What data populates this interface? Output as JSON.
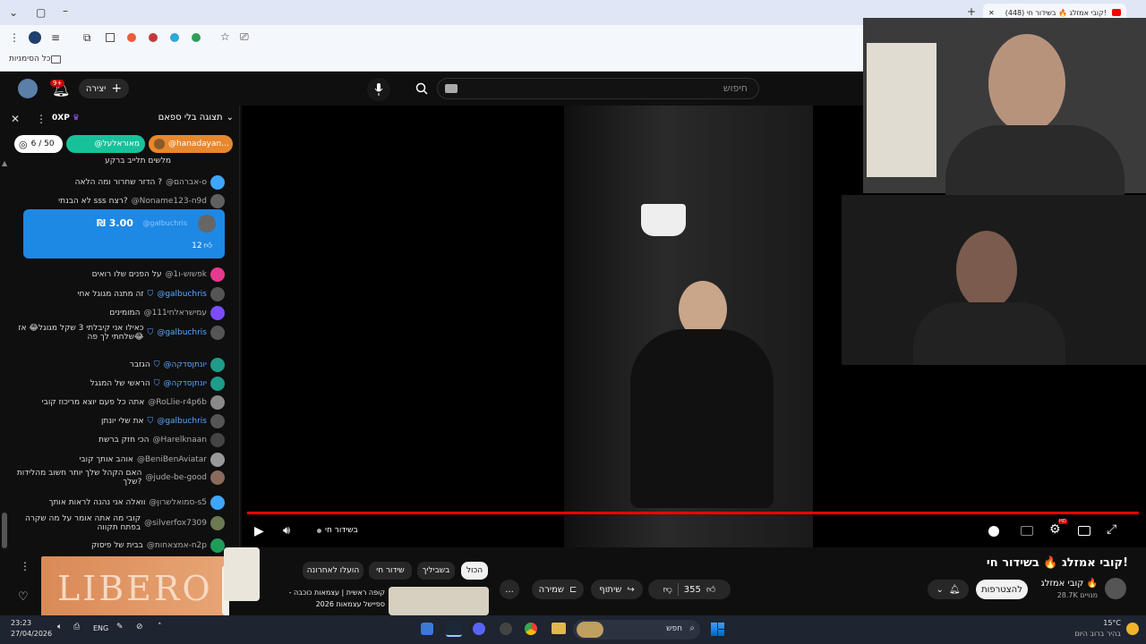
{
  "browser": {
    "tab_title": "(448) קובי אמזלג 🔥 בשידור חי!",
    "bookmarks_label": "כל הסימניות"
  },
  "header": {
    "create_label": "יצירה",
    "notifications_badge": "9+",
    "search_placeholder": "חיפוש"
  },
  "chat": {
    "view_mode": "תצוגה בלי ספאם",
    "xp": "0XP",
    "goal": "6 / 50",
    "pinned_users": [
      "@מאוראלעל",
      "@hanadayan..."
    ],
    "top_cut": "מלשים תלייב ברקע",
    "super_chat": {
      "amount": "₪ 3.00",
      "author": "@galbuchris",
      "likes": "12"
    },
    "messages": [
      {
        "author": "@אברהם-o",
        "text": "הדזר שחרור ומה הלאה ?",
        "color": "#3ea6ff",
        "mod": false
      },
      {
        "author": "@Noname123-n9d",
        "text": "לא הבנתי sss רצח?",
        "color": "#606060",
        "mod": false
      },
      {
        "author": "@פשוש-ו1k",
        "text": "על הפנים שלו רואים",
        "color": "#e53a8f",
        "mod": false
      },
      {
        "author": "@galbuchris",
        "text": "זה מתנה מגוגל אחי",
        "color": "#555",
        "mod": true
      },
      {
        "author": "@עמישראלחי111",
        "text": "המומינים",
        "color": "#7c4dff",
        "mod": false
      },
      {
        "author": "@galbuchris",
        "text": "כאילו אני קיבלתי 3 שקל מגוגל😂 אז שלחתי לך פה😂",
        "color": "#555",
        "mod": true
      },
      {
        "author": "@יונתןסדקה",
        "text": "הגזבר",
        "color": "#1e9c8a",
        "mod": true
      },
      {
        "author": "@יונתןסדקה",
        "text": "הראשי של המגגל",
        "color": "#1e9c8a",
        "mod": true
      },
      {
        "author": "@RoLlie-r4p6b",
        "text": "אתה כל פעם יוצא מריכוז קובי",
        "color": "#8a8a8a",
        "mod": false
      },
      {
        "author": "@galbuchris",
        "text": "את שלי יונתן",
        "color": "#555",
        "mod": true
      },
      {
        "author": "@Harelknaan",
        "text": "הכי חזק ברשת",
        "color": "#444",
        "mod": false
      },
      {
        "author": "@BeniBenAviatar",
        "text": "אוהב אותך קובי",
        "color": "#999",
        "mod": false
      },
      {
        "author": "@jude-be-good",
        "text": "האם הקהל שלך יותר חשוב מהלידות שלך?",
        "color": "#8a6a5a",
        "mod": false
      },
      {
        "author": "@סמואלשרון-s5",
        "text": "וואלה אני נהנה לראות אותך",
        "color": "#3ea6ff",
        "mod": false
      },
      {
        "author": "@silverfox7309",
        "text": "קובי מה אתה אומר על מה שקרה בפתח תקווה",
        "color": "#6b7a50",
        "mod": false
      },
      {
        "author": "@אמצאחות-n2p",
        "text": "בבית של פיסוק",
        "color": "#1e9c5a",
        "mod": false
      }
    ]
  },
  "player": {
    "live_label": "בשידור חי",
    "settings_badge": "HD"
  },
  "video": {
    "title": "קובי אמזלג 🔥 בשידור חי!",
    "channel_name": "קובי אמזלג 🔥",
    "subscribers": "28.7K מנויים",
    "subscribe_label": "להצטרפות",
    "likes": "355",
    "share_label": "שיתוף",
    "save_label": "שמירה",
    "more_label": "..."
  },
  "chips": [
    "הכול",
    "בשביליך",
    "שידור חי",
    "הועלו לאחרונה"
  ],
  "recommendation": {
    "title": "קופה ראשית | עצמאות כוכבה - ספיישל עצמאות 2026"
  },
  "ad": {
    "brand": "LIBERO"
  },
  "taskbar": {
    "search_placeholder": "חפש",
    "lang": "ENG",
    "time": "23:23",
    "date": "27/04/2026",
    "weather_temp": "15°C",
    "weather_desc": "בהיר ברוב היום"
  },
  "colors": {
    "progress": "#ff0000",
    "accent": "#3ea6ff",
    "super_chat": "#1e88e5"
  }
}
